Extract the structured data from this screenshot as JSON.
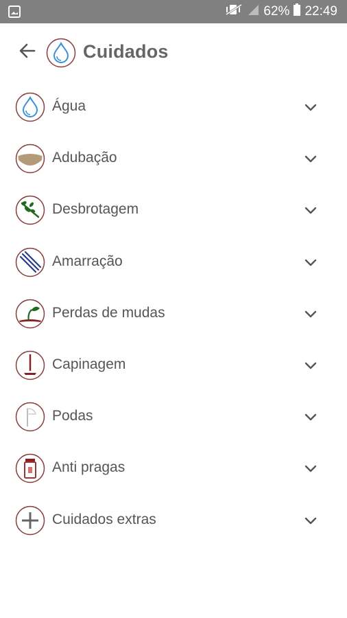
{
  "status_bar": {
    "battery": "62%",
    "time": "22:49",
    "icons": [
      "image-notification-icon",
      "vibrate-mute-icon",
      "signal-icon",
      "battery-icon"
    ]
  },
  "header": {
    "title": "Cuidados",
    "back_icon": "arrow-back-icon",
    "title_icon": "water-drop-icon"
  },
  "items": [
    {
      "label": "Água",
      "icon": "water-drop-icon"
    },
    {
      "label": "Adubação",
      "icon": "fertilizer-icon"
    },
    {
      "label": "Desbrotagem",
      "icon": "sprout-removal-icon"
    },
    {
      "label": "Amarração",
      "icon": "tying-icon"
    },
    {
      "label": "Perdas de mudas",
      "icon": "seedling-icon"
    },
    {
      "label": "Capinagem",
      "icon": "hoe-icon"
    },
    {
      "label": "Podas",
      "icon": "pruning-icon"
    },
    {
      "label": "Anti pragas",
      "icon": "pesticide-icon"
    },
    {
      "label": "Cuidados extras",
      "icon": "plus-icon"
    }
  ],
  "colors": {
    "status_bar": "#808080",
    "icon_ring": "#8a3a3a",
    "water_blue": "#3b8fd8",
    "soil_brown": "#b59a7a",
    "leaf_green": "#1f6b1f",
    "text": "#555555"
  }
}
